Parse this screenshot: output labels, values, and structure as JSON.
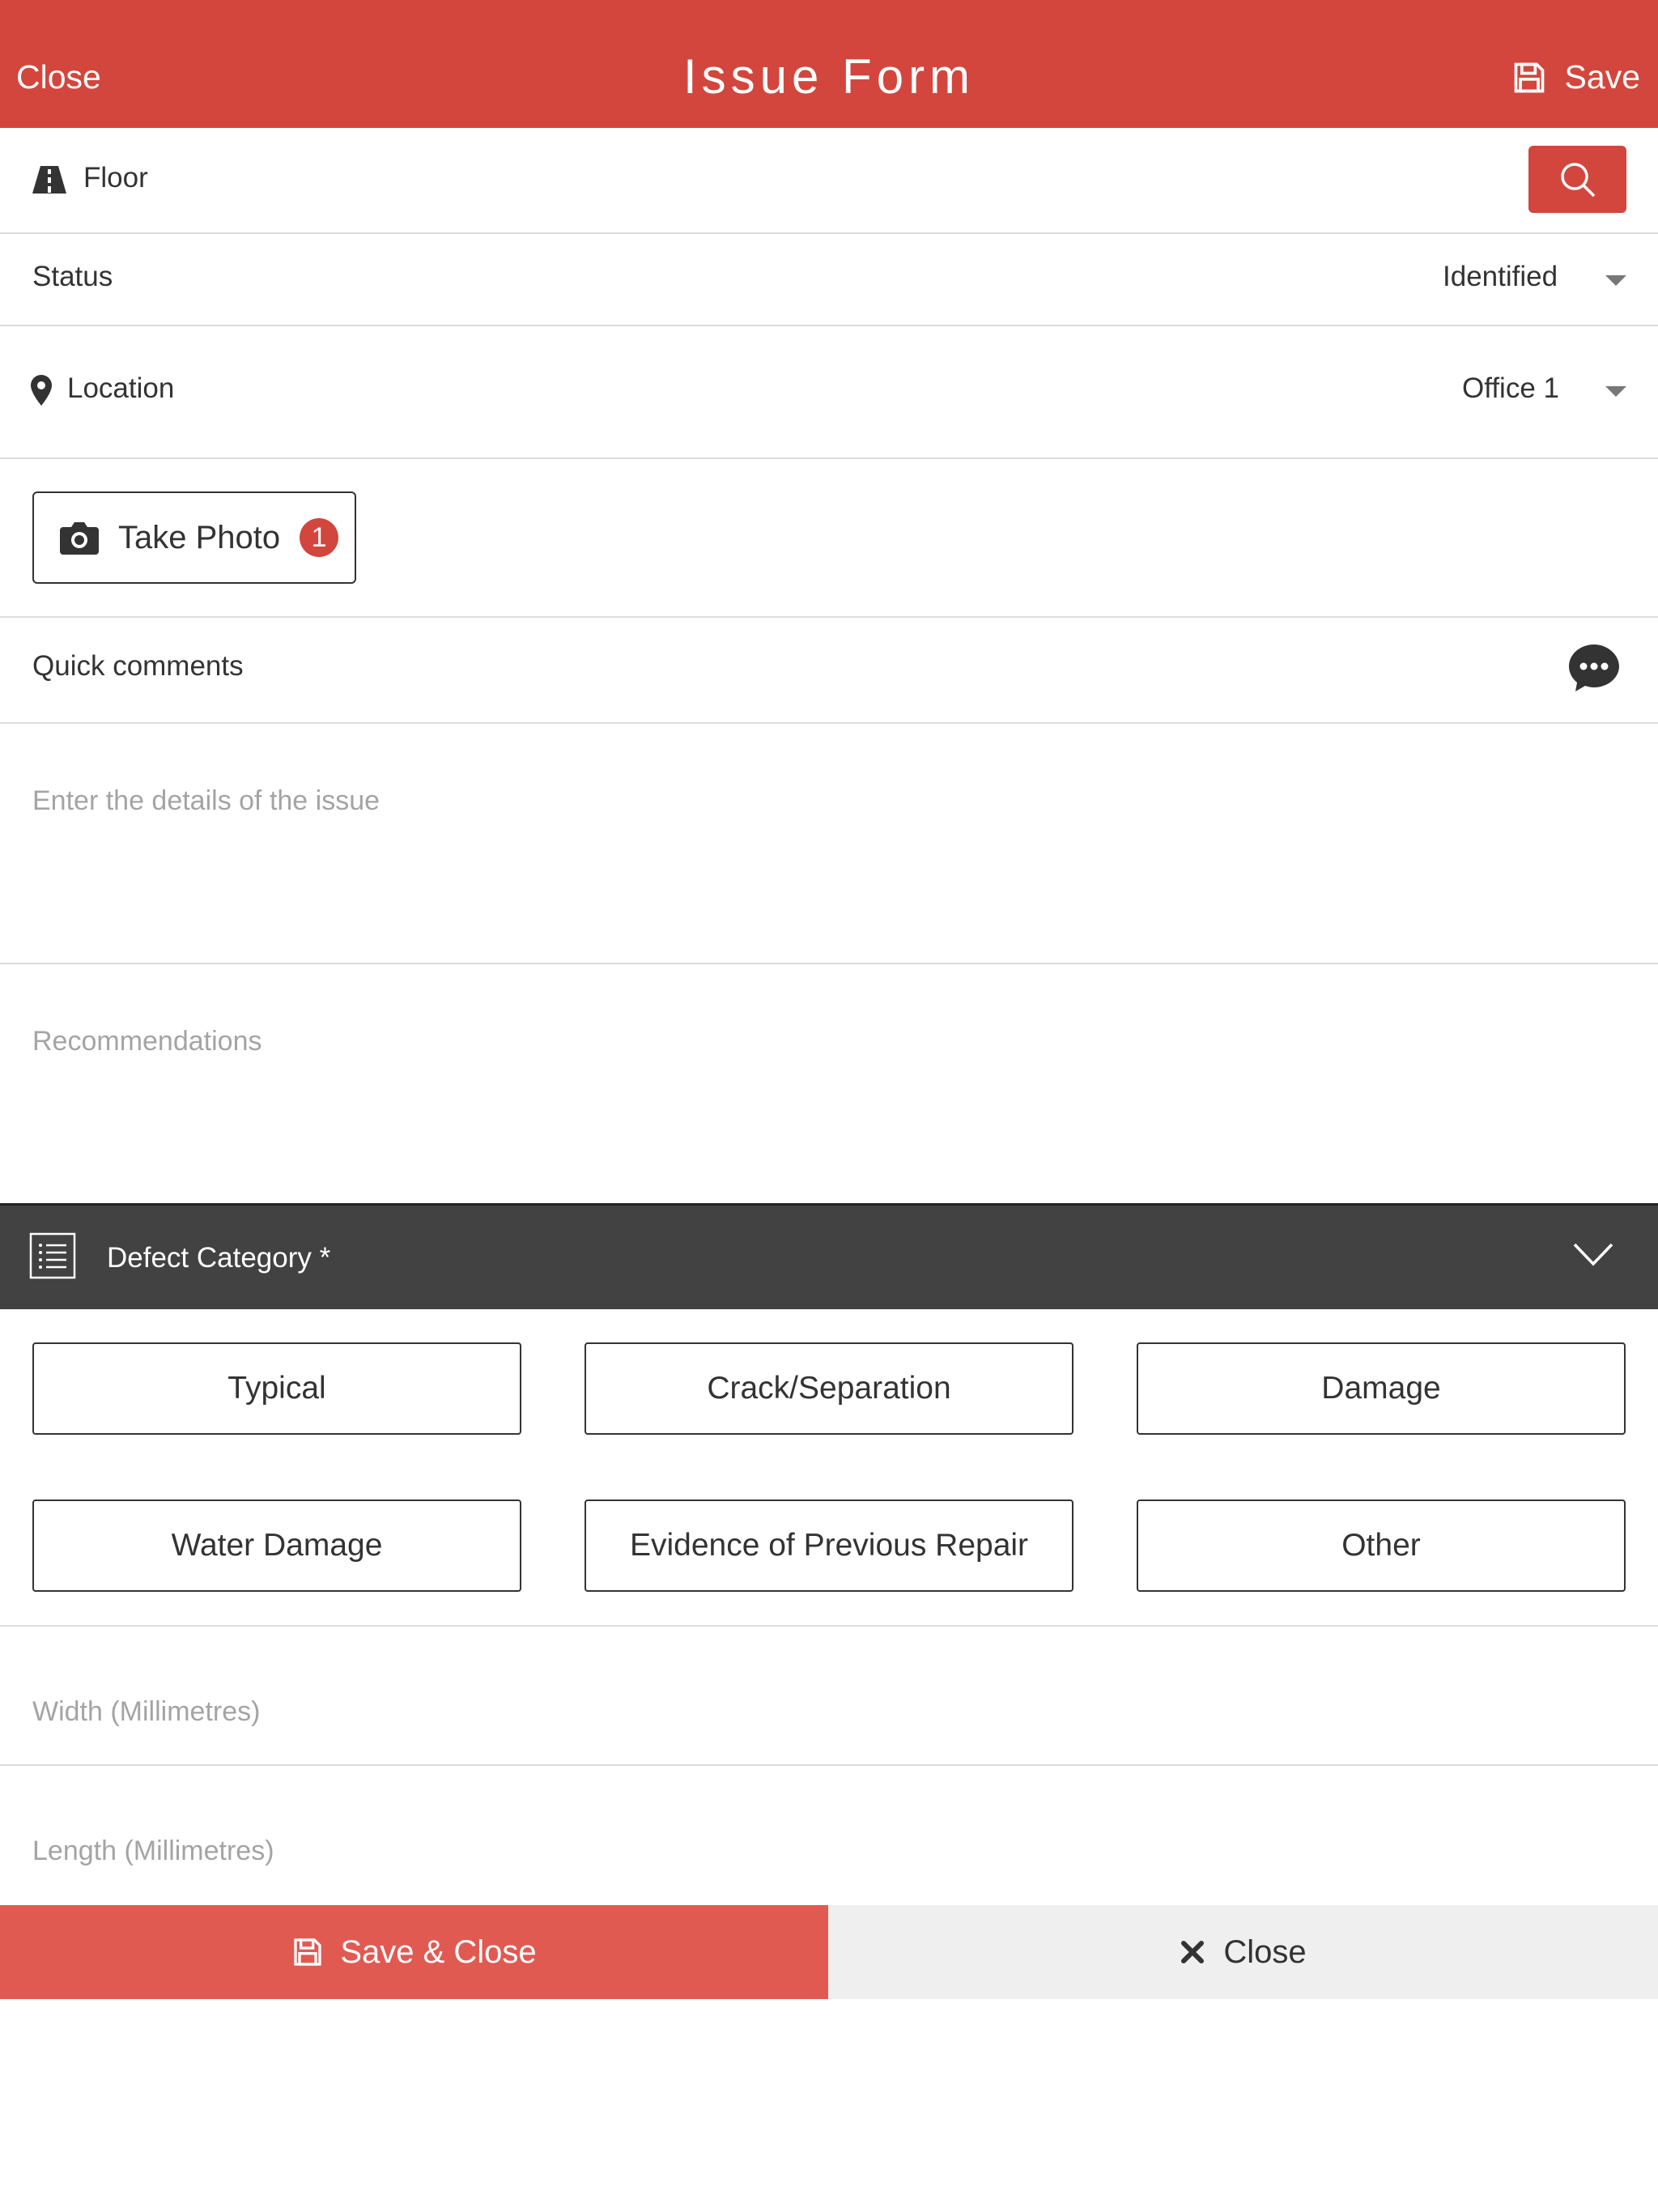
{
  "header": {
    "close_label": "Close",
    "title": "Issue Form",
    "save_label": "Save",
    "background_color": "#d3463d"
  },
  "floor": {
    "label": "Floor",
    "icon": "road-icon",
    "search_icon": "search-icon"
  },
  "status": {
    "label": "Status",
    "value": "Identified"
  },
  "location": {
    "label": "Location",
    "value": "Office 1",
    "icon": "map-pin-icon"
  },
  "photo": {
    "label": "Take Photo",
    "count": "1",
    "icon": "camera-icon"
  },
  "quick_comments": {
    "label": "Quick comments",
    "icon": "speech-bubble-icon"
  },
  "details": {
    "placeholder": "Enter the details of the issue"
  },
  "recommendations": {
    "placeholder": "Recommendations"
  },
  "defect_category": {
    "label": "Defect Category *",
    "icon": "list-icon",
    "options": [
      "Typical",
      "Crack/Separation",
      "Damage",
      "Water Damage",
      "Evidence of Previous Repair",
      "Other"
    ]
  },
  "width": {
    "placeholder": "Width (Millimetres)"
  },
  "length": {
    "placeholder": "Length (Millimetres)"
  },
  "footer": {
    "save_close_label": "Save & Close",
    "close_label": "Close",
    "save_color": "#e05a52"
  }
}
